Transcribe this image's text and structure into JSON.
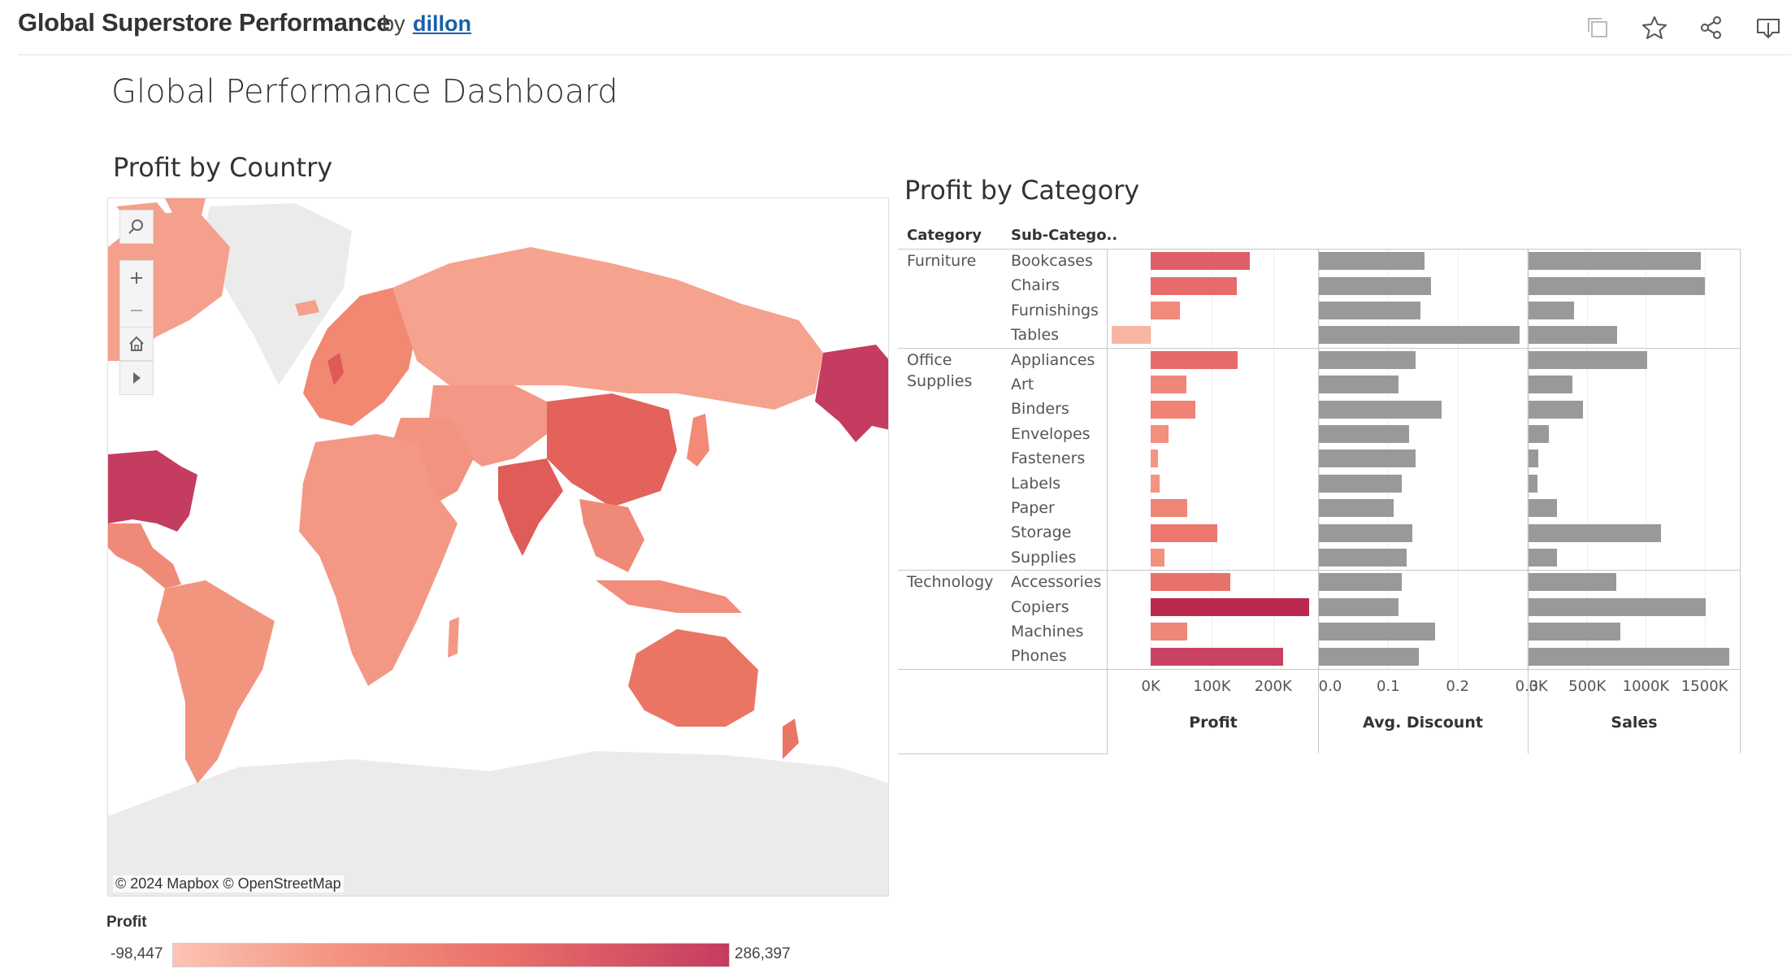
{
  "header": {
    "viz_title": "Global Superstore Performance",
    "by": "by",
    "author": "dillon",
    "icons": [
      "copy-icon",
      "star-icon",
      "share-icon",
      "download-icon"
    ]
  },
  "dashboard": {
    "title": "Global Performance Dashboard"
  },
  "map": {
    "title": "Profit by Country",
    "credit": "© 2024 Mapbox  © OpenStreetMap",
    "controls": [
      "search-icon",
      "zoom-in-icon",
      "zoom-out-icon",
      "home-icon",
      "expand-arrow-icon"
    ],
    "legend": {
      "title": "Profit",
      "min": "-98,447",
      "max": "286,397"
    },
    "colors": {
      "low": "#fcc3b4",
      "high": "#c43c60",
      "land_nodata": "#e8e8e8"
    }
  },
  "category": {
    "title": "Profit by Category",
    "col_category": "Category",
    "col_subcategory": "Sub-Catego..",
    "groups": [
      {
        "name": "Furniture",
        "rows": [
          {
            "sub": "Bookcases",
            "profit": 161900,
            "discount": 0.152,
            "sales": 1466600
          },
          {
            "sub": "Chairs",
            "profit": 141000,
            "discount": 0.162,
            "sales": 1501700
          },
          {
            "sub": "Furnishings",
            "profit": 46900,
            "discount": 0.147,
            "sales": 385600
          },
          {
            "sub": "Tables",
            "profit": -64000,
            "discount": 0.29,
            "sales": 757000
          }
        ]
      },
      {
        "name": "Office Supplies",
        "name_lines": [
          "Office",
          "Supplies"
        ],
        "rows": [
          {
            "sub": "Appliances",
            "profit": 141700,
            "discount": 0.139,
            "sales": 1011000
          },
          {
            "sub": "Art",
            "profit": 57900,
            "discount": 0.115,
            "sales": 372000
          },
          {
            "sub": "Binders",
            "profit": 72400,
            "discount": 0.177,
            "sales": 461900
          },
          {
            "sub": "Envelopes",
            "profit": 29600,
            "discount": 0.13,
            "sales": 170900
          },
          {
            "sub": "Fasteners",
            "profit": 11500,
            "discount": 0.139,
            "sales": 83200
          },
          {
            "sub": "Labels",
            "profit": 15000,
            "discount": 0.119,
            "sales": 73400
          },
          {
            "sub": "Paper",
            "profit": 59200,
            "discount": 0.108,
            "sales": 244300
          },
          {
            "sub": "Storage",
            "profit": 108500,
            "discount": 0.135,
            "sales": 1127100
          },
          {
            "sub": "Supplies",
            "profit": 22600,
            "discount": 0.126,
            "sales": 243100
          }
        ]
      },
      {
        "name": "Technology",
        "rows": [
          {
            "sub": "Accessories",
            "profit": 129600,
            "discount": 0.119,
            "sales": 749200
          },
          {
            "sub": "Copiers",
            "profit": 258600,
            "discount": 0.115,
            "sales": 1509400
          },
          {
            "sub": "Machines",
            "profit": 58900,
            "discount": 0.168,
            "sales": 779100
          },
          {
            "sub": "Phones",
            "profit": 216700,
            "discount": 0.144,
            "sales": 1706800
          }
        ]
      }
    ],
    "axes": {
      "profit": {
        "title": "Profit",
        "ticks": [
          "0K",
          "100K",
          "200K"
        ],
        "tick_values": [
          0,
          100000,
          200000
        ],
        "range": [
          -68000,
          272000
        ]
      },
      "discount": {
        "title": "Avg. Discount",
        "ticks": [
          "0.0",
          "0.1",
          "0.2",
          "0.3"
        ],
        "tick_values": [
          0,
          0.1,
          0.2,
          0.3
        ],
        "range": [
          0,
          0.3
        ]
      },
      "sales": {
        "title": "Sales",
        "ticks": [
          "0K",
          "500K",
          "1000K",
          "1500K"
        ],
        "tick_values": [
          0,
          500000,
          1000000,
          1500000
        ],
        "range": [
          0,
          1800000
        ]
      }
    },
    "colors": {
      "discount_bar": "#999999",
      "sales_bar": "#999999"
    }
  }
}
